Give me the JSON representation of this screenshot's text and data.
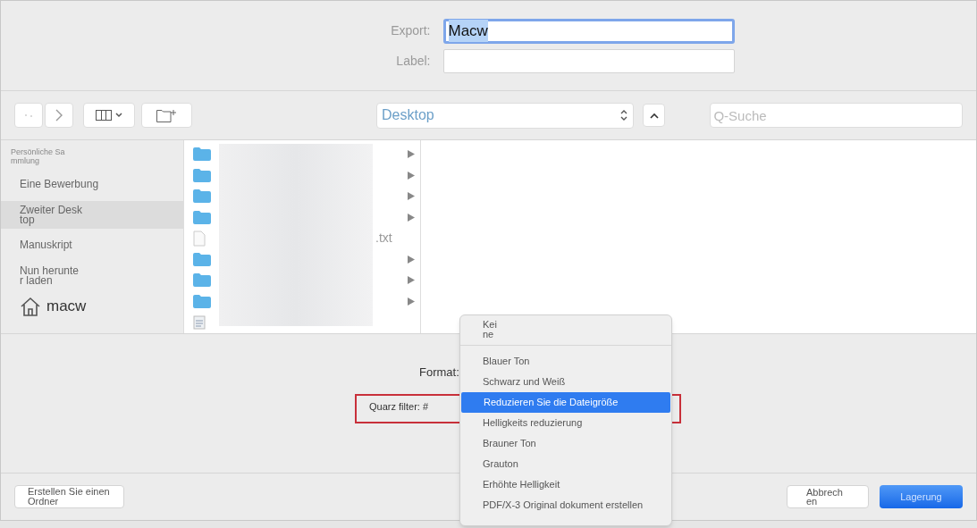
{
  "export": {
    "label": "Export:",
    "value": "Macw"
  },
  "tag": {
    "label": "Label:"
  },
  "toolbar": {
    "location": "Desktop",
    "search_placeholder": "Q-Suche"
  },
  "sidebar": {
    "header": "Persönliche Sa\nmmlung",
    "items": [
      {
        "label": "Eine Bewerbung",
        "selected": false,
        "kind": "plain"
      },
      {
        "label": "Zweiter Desk\ntop",
        "selected": true,
        "kind": "plain"
      },
      {
        "label": "Manuskript",
        "selected": false,
        "kind": "plain"
      },
      {
        "label": "Nun herunte\nr laden",
        "selected": false,
        "kind": "plain"
      },
      {
        "label": "macw",
        "selected": false,
        "kind": "home"
      }
    ]
  },
  "files": [
    {
      "kind": "folder"
    },
    {
      "kind": "folder"
    },
    {
      "kind": "folder"
    },
    {
      "kind": "folder"
    },
    {
      "kind": "file",
      "name": ".txt"
    },
    {
      "kind": "folder"
    },
    {
      "kind": "folder"
    },
    {
      "kind": "folder"
    },
    {
      "kind": "doc"
    }
  ],
  "format": {
    "label": "Format:"
  },
  "quartz": {
    "label": "Quarz filter: #"
  },
  "menu": {
    "items": [
      {
        "label": "Kei\nne",
        "selected": false,
        "separator_after": true
      },
      {
        "label": "Blauer Ton",
        "selected": false,
        "separator_after": false
      },
      {
        "label": "Schwarz und Weiß",
        "selected": false,
        "separator_after": false
      },
      {
        "label": "Reduzieren Sie die Dateigröße",
        "selected": true,
        "separator_after": false
      },
      {
        "label": "Helligkeits reduzierung",
        "selected": false,
        "separator_after": false
      },
      {
        "label": "Brauner Ton",
        "selected": false,
        "separator_after": false
      },
      {
        "label": "Grauton",
        "selected": false,
        "separator_after": false
      },
      {
        "label": "Erhöhte Helligkeit",
        "selected": false,
        "separator_after": false
      },
      {
        "label": "PDF/X-3 Original dokument erstellen",
        "selected": false,
        "separator_after": false
      }
    ]
  },
  "buttons": {
    "new_folder": "Erstellen Sie einen Ordner",
    "cancel": "Abbrech\nen",
    "save": "Lagerung"
  }
}
